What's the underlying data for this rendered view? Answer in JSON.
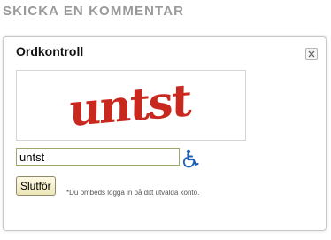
{
  "section": {
    "heading": "SKICKA EN KOMMENTAR"
  },
  "dialog": {
    "title": "Ordkontroll",
    "close_icon": "close-icon",
    "captcha": {
      "text": "untst",
      "text_color": "#c8281e"
    },
    "answer_value": "untst",
    "audio_icon": "wheelchair-accessibility-icon",
    "audio_icon_color": "#1a5fb4",
    "submit_label": "Slutför",
    "note": "*Du ombeds logga in på ditt utvalda konto."
  }
}
